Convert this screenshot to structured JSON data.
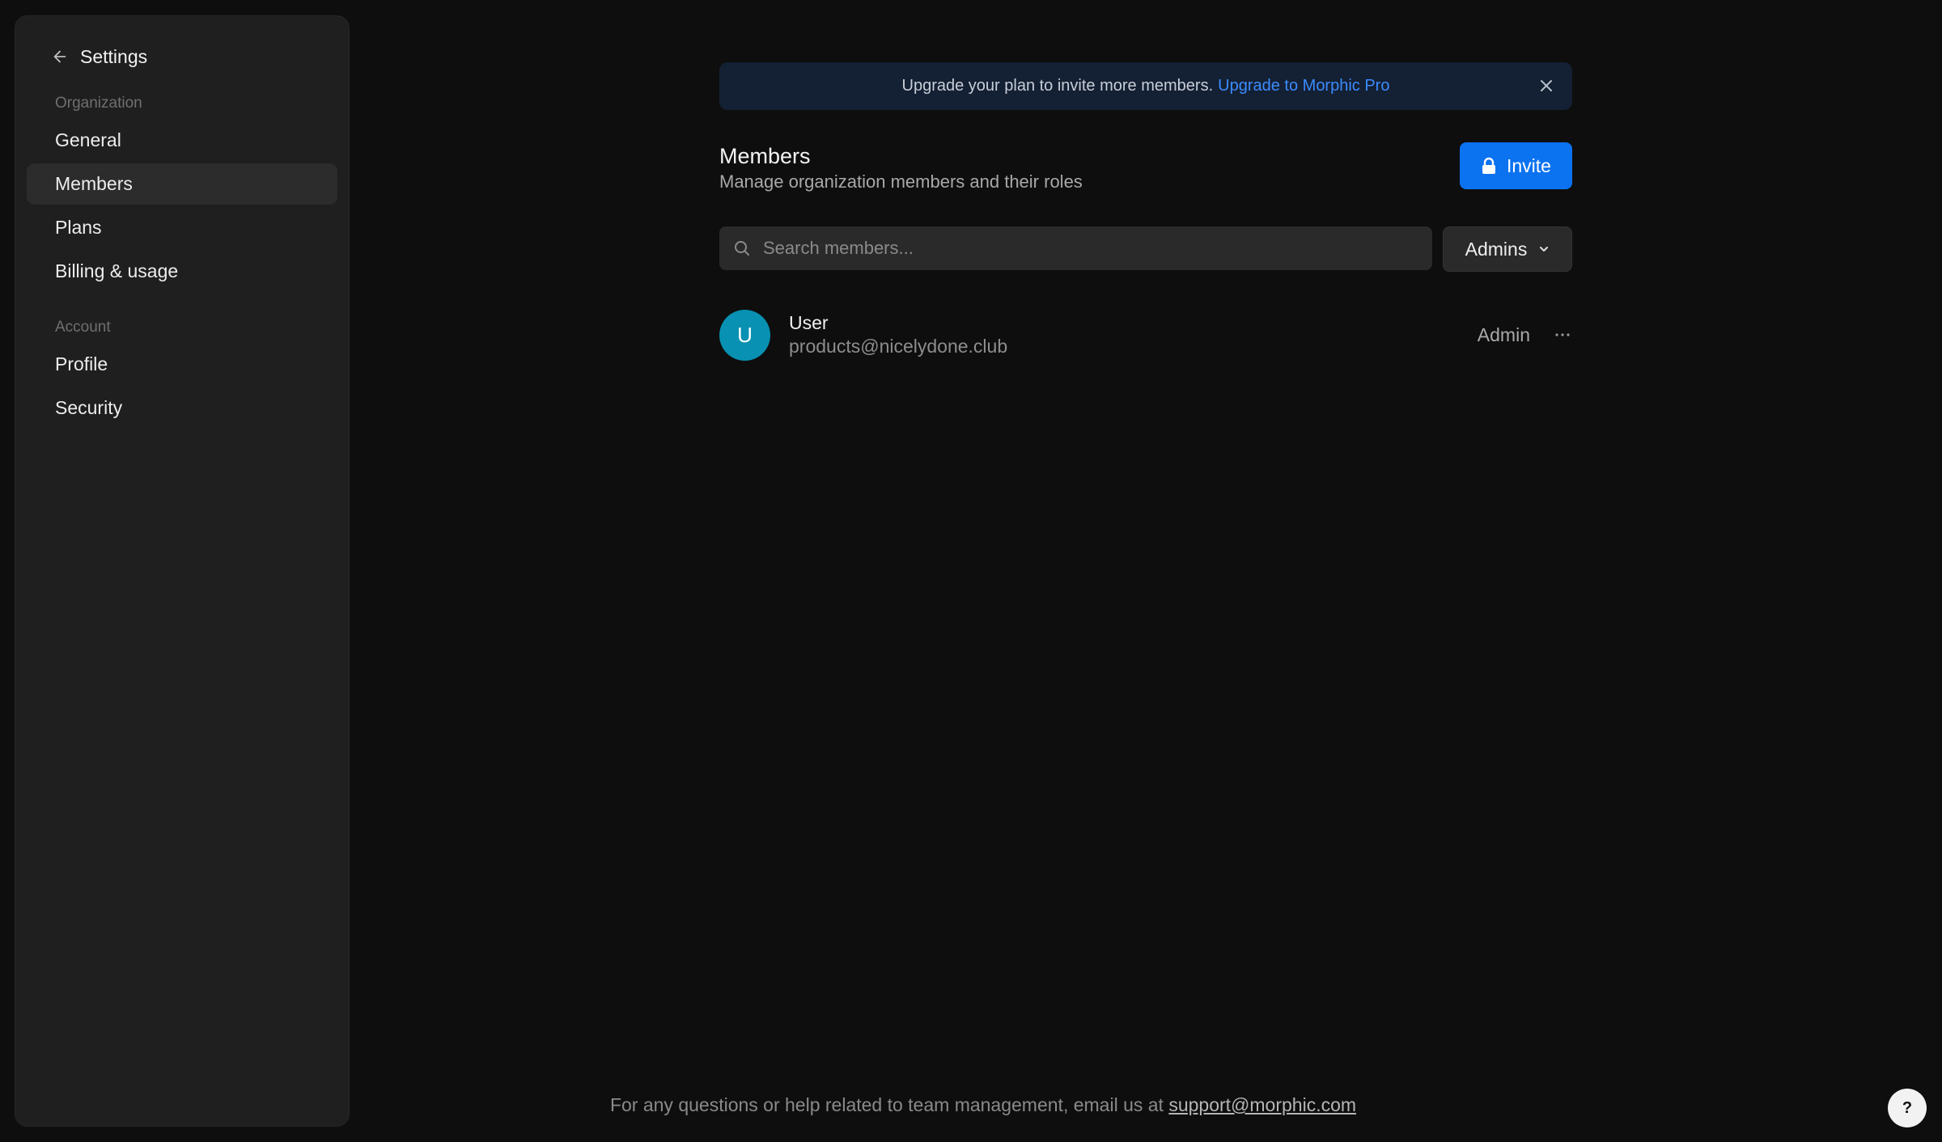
{
  "sidebar": {
    "title": "Settings",
    "sections": [
      {
        "label": "Organization",
        "items": [
          {
            "label": "General"
          },
          {
            "label": "Members",
            "active": true
          },
          {
            "label": "Plans"
          },
          {
            "label": "Billing & usage"
          }
        ]
      },
      {
        "label": "Account",
        "items": [
          {
            "label": "Profile"
          },
          {
            "label": "Security"
          }
        ]
      }
    ]
  },
  "banner": {
    "text": "Upgrade your plan to invite more members.",
    "link": "Upgrade to Morphic Pro"
  },
  "header": {
    "title": "Members",
    "subtitle": "Manage organization members and their roles",
    "invite_label": "Invite"
  },
  "search": {
    "placeholder": "Search members...",
    "value": ""
  },
  "filter": {
    "selected": "Admins"
  },
  "members": [
    {
      "initial": "U",
      "name": "User",
      "email": "products@nicelydone.club",
      "role": "Admin"
    }
  ],
  "footer": {
    "text": "For any questions or help related to team management, email us at",
    "email": "support@morphic.com"
  },
  "help": {
    "label": "?"
  },
  "colors": {
    "accent": "#0b72f0",
    "link": "#3b8cff",
    "avatar": "#0891b2",
    "banner_bg": "#142033"
  },
  "icons": {
    "back": "arrow-left-icon",
    "close": "close-icon",
    "lock": "lock-icon",
    "search": "search-icon",
    "chevron": "chevron-down-icon",
    "more": "more-horizontal-icon"
  }
}
